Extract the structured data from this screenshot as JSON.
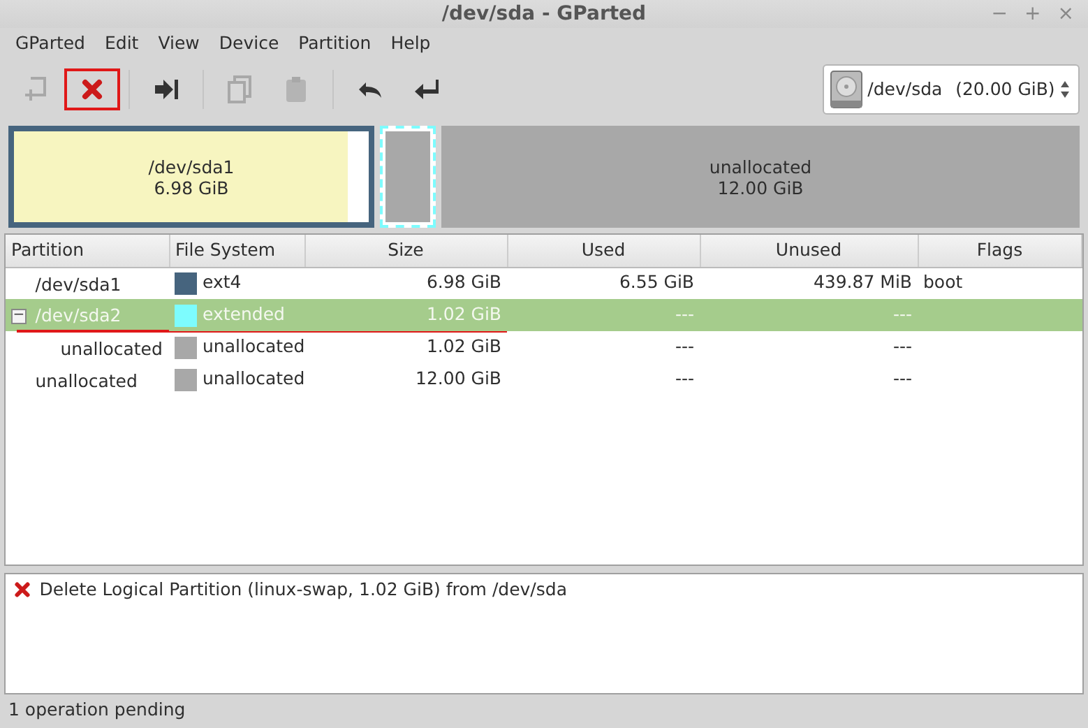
{
  "window": {
    "title": "/dev/sda - GParted",
    "controls": [
      "−",
      "+",
      "×"
    ]
  },
  "menu": [
    "GParted",
    "Edit",
    "View",
    "Device",
    "Partition",
    "Help"
  ],
  "toolbar": [
    {
      "kind": "new",
      "disabled": true,
      "highlighted": false
    },
    {
      "kind": "delete",
      "disabled": false,
      "highlighted": true
    },
    {
      "kind": "resize",
      "disabled": false,
      "highlighted": false
    },
    {
      "kind": "copy",
      "disabled": true,
      "highlighted": false
    },
    {
      "kind": "paste",
      "disabled": true,
      "highlighted": false
    },
    {
      "kind": "undo",
      "disabled": false,
      "highlighted": false
    },
    {
      "kind": "apply",
      "disabled": false,
      "highlighted": false
    }
  ],
  "device": {
    "name": "/dev/sda",
    "size": "(20.00 GiB)"
  },
  "disk_map": [
    {
      "kind": "primary",
      "name": "/dev/sda1",
      "size": "6.98 GiB",
      "level": 0.94,
      "selected": false,
      "color": "#46647e"
    },
    {
      "kind": "extended",
      "selected": true,
      "color": "#7dfcfe"
    },
    {
      "kind": "unallocated",
      "name": "unallocated",
      "size": "12.00 GiB",
      "selected": false,
      "color": "#a8a8a8"
    }
  ],
  "table": {
    "columns": [
      "Partition",
      "File System",
      "Size",
      "Used",
      "Unused",
      "Flags"
    ],
    "rows": [
      {
        "partition": "/dev/sda1",
        "color": "#46647e",
        "fs": "ext4",
        "size": "6.98 GiB",
        "used": "6.55 GiB",
        "unused": "439.87 MiB",
        "flags": "boot",
        "selected": false,
        "underlined": false
      },
      {
        "partition": "/dev/sda2",
        "color": "#7dfcfe",
        "fs": "extended",
        "size": "1.02 GiB",
        "used": "---",
        "unused": "---",
        "selected": true,
        "underlined": true,
        "expanded": true,
        "expander": "−",
        "children": [
          {
            "partition": "unallocated",
            "color": "#a8a8a8",
            "fs": "unallocated",
            "size": "1.02 GiB",
            "used": "---",
            "unused": "---",
            "selected": false,
            "underlined": false
          }
        ]
      },
      {
        "partition": "unallocated",
        "color": "#a8a8a8",
        "fs": "unallocated",
        "size": "12.00 GiB",
        "used": "---",
        "unused": "---",
        "selected": false,
        "underlined": false
      }
    ]
  },
  "operations": [
    {
      "kind": "delete",
      "text": "Delete Logical Partition (linux-swap, 1.02 GiB) from /dev/sda"
    }
  ],
  "status_bar": "1 operation pending"
}
